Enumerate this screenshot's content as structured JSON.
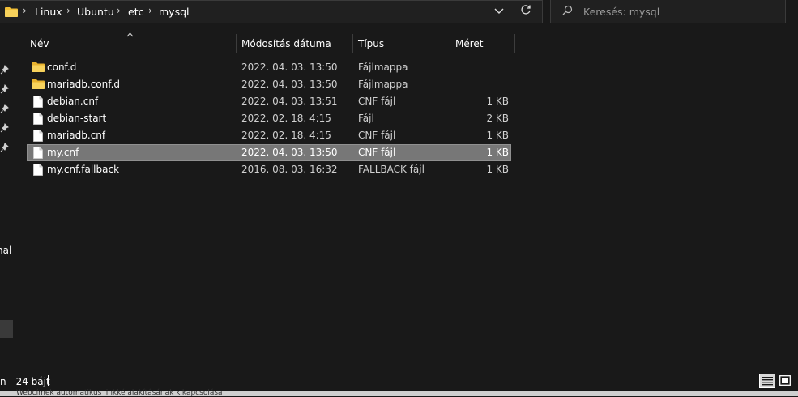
{
  "breadcrumb": {
    "items": [
      "Linux",
      "Ubuntu",
      "etc",
      "mysql"
    ],
    "separator": "›"
  },
  "search": {
    "placeholder": "Keresés: mysql"
  },
  "columns": {
    "name": "Név",
    "date": "Módosítás dátuma",
    "type": "Típus",
    "size": "Méret"
  },
  "files": [
    {
      "name": "conf.d",
      "date": "2022. 04. 03. 13:50",
      "type": "Fájlmappa",
      "size": "",
      "icon": "folder-icon",
      "selected": false
    },
    {
      "name": "mariadb.conf.d",
      "date": "2022. 04. 03. 13:50",
      "type": "Fájlmappa",
      "size": "",
      "icon": "folder-icon",
      "selected": false
    },
    {
      "name": "debian.cnf",
      "date": "2022. 04. 03. 13:51",
      "type": "CNF fájl",
      "size": "1 KB",
      "icon": "file-icon",
      "selected": false
    },
    {
      "name": "debian-start",
      "date": "2022. 02. 18. 4:15",
      "type": "Fájl",
      "size": "2 KB",
      "icon": "file-icon",
      "selected": false
    },
    {
      "name": "mariadb.cnf",
      "date": "2022. 02. 18. 4:15",
      "type": "CNF fájl",
      "size": "1 KB",
      "icon": "file-icon",
      "selected": false
    },
    {
      "name": "my.cnf",
      "date": "2022. 04. 03. 13:50",
      "type": "CNF fájl",
      "size": "1 KB",
      "icon": "file-icon",
      "selected": true
    },
    {
      "name": "my.cnf.fallback",
      "date": "2016. 08. 03. 16:32",
      "type": "FALLBACK fájl",
      "size": "1 KB",
      "icon": "file-icon",
      "selected": false
    }
  ],
  "nav": {
    "partial_label": "nal"
  },
  "status": {
    "text": "n - 24 bájt"
  },
  "bottom": {
    "text": "Webcímek automatikus linkké alakításának kikapcsolása"
  },
  "colors": {
    "folder": "#f2c037",
    "selected_row": "#777777",
    "background": "#191919"
  }
}
